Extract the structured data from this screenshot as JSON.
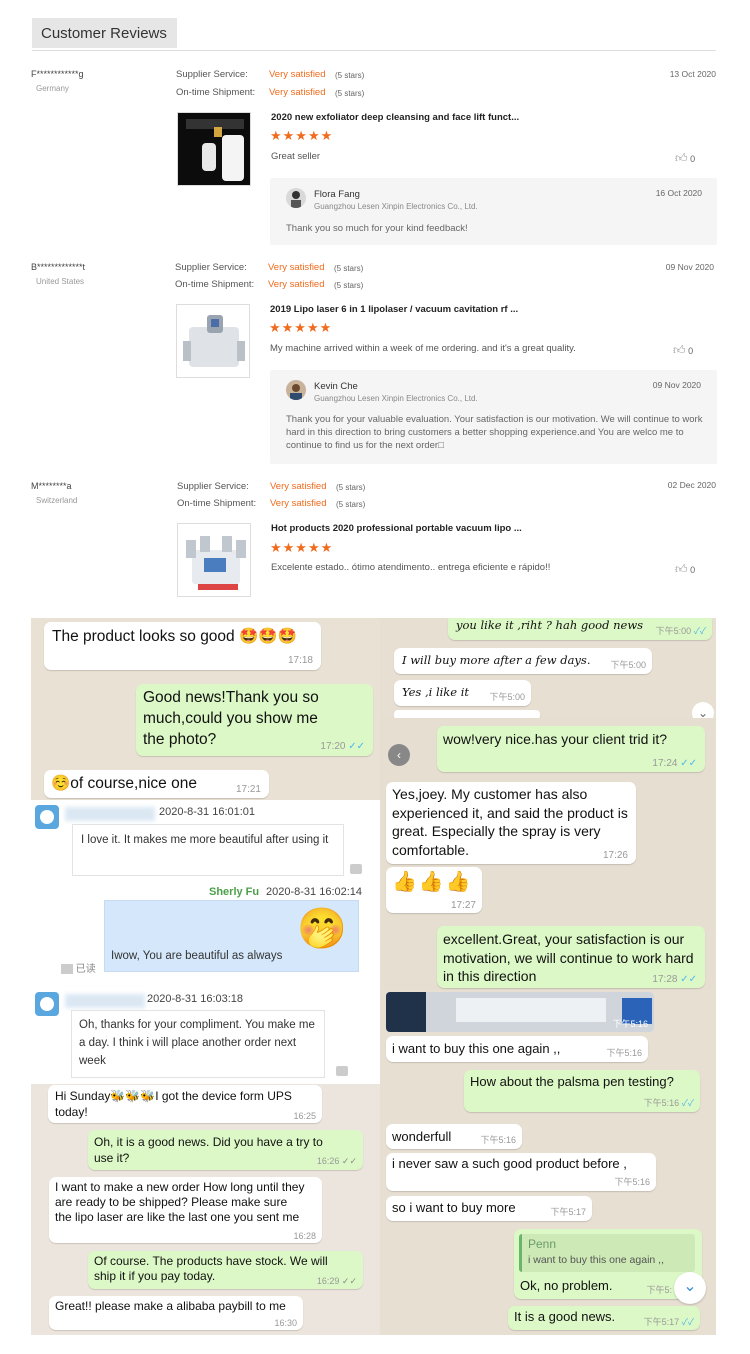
{
  "header": {
    "title": "Customer Reviews"
  },
  "reviews": [
    {
      "name": "F************g",
      "country": "Germany",
      "supplier_label": "Supplier Service:",
      "supplier_value": "Very satisfied",
      "supplier_stars": "(5 stars)",
      "shipment_label": "On-time Shipment:",
      "shipment_value": "Very satisfied",
      "shipment_stars": "(5 stars)",
      "date": "13 Oct 2020",
      "product": "2020 new exfoliator deep cleansing and face lift funct...",
      "rating": "★★★★★",
      "comment": "Great seller",
      "likes": "0",
      "reply": {
        "name": "Flora Fang",
        "company": "Guangzhou Lesen Xinpin Electronics Co., Ltd.",
        "date": "16 Oct 2020",
        "text": "Thank you so much for your kind feedback!"
      }
    },
    {
      "name": "B*************t",
      "country": "United States",
      "supplier_label": "Supplier Service:",
      "supplier_value": "Very satisfied",
      "supplier_stars": "(5 stars)",
      "shipment_label": "On-time Shipment:",
      "shipment_value": "Very satisfied",
      "shipment_stars": "(5 stars)",
      "date": "09 Nov 2020",
      "product": "2019 Lipo laser 6 in 1 lipolaser / vacuum cavitation rf ...",
      "rating": "★★★★★",
      "comment": "My machine arrived within a week of me ordering. and it's a great quality.",
      "likes": "0",
      "reply": {
        "name": "Kevin Che",
        "company": "Guangzhou Lesen Xinpin Electronics Co., Ltd.",
        "date": "09 Nov 2020",
        "text": "Thank you for your valuable evaluation. Your satisfaction is our motivation. We will continue to work hard in this direction to bring customers a better shopping experience.and You are welco me to continue to find us for the next order□"
      }
    },
    {
      "name": "M********a",
      "country": "Switzerland",
      "supplier_label": "Supplier Service:",
      "supplier_value": "Very satisfied",
      "supplier_stars": "(5 stars)",
      "shipment_label": "On-time Shipment:",
      "shipment_value": "Very satisfied",
      "shipment_stars": "(5 stars)",
      "date": "02 Dec 2020",
      "product": "Hot products 2020 professional portable vacuum lipo ...",
      "rating": "★★★★★",
      "comment": "Excelente estado.. ótimo atendimento.. entrega eficiente e rápido!!",
      "likes": "0"
    }
  ],
  "chat_left": {
    "m1": {
      "text": "The product looks so good 🤩🤩🤩",
      "time": "17:18"
    },
    "m2": {
      "text": "Good news!Thank you so much,could you show me the photo?",
      "time": "17:20",
      "check": "✓✓"
    },
    "m3": {
      "text": "☺️of course,nice one",
      "time": "17:21"
    },
    "w1": {
      "date": "2020-8-31 16:01:01",
      "text": "I love it. It makes me more beautiful after using it"
    },
    "w2": {
      "name": "Sherly Fu",
      "date": "2020-8-31 16:02:14",
      "text": "Iwow, You are beautiful as always",
      "read": "已读",
      "emoji": "🤭"
    },
    "w3": {
      "date": "2020-8-31 16:03:18",
      "text": "Oh, thanks for your compliment. You make me a day. I think i will place another order next week"
    },
    "s1": {
      "text": "Hi Sunday🐝🐝🐝I got the device form UPS today!",
      "time": "16:25"
    },
    "s2": {
      "text": "Oh, it is a good news. Did you have a try to use it?",
      "time": "16:26",
      "check": "✓✓"
    },
    "s3": {
      "text": "I want to make a new order How long until they are ready to be shipped? Please make sure the lipo laser are like the last one you sent me",
      "time": "16:28"
    },
    "s4": {
      "text": "Of course. The products have stock. We will ship it if you pay today.",
      "time": "16:29",
      "check": "✓✓"
    },
    "s5": {
      "text": "Great!! please make a alibaba paybill to me",
      "time": "16:30"
    }
  },
  "chat_right": {
    "h1": {
      "text": "you like it ,riht ? hah good news",
      "time": "下午5:00",
      "check": "✓✓"
    },
    "h2": {
      "text": "I will buy more after a few days.",
      "time": "下午5:00"
    },
    "h3": {
      "text": "Yes ,i like it",
      "time": "下午5:00"
    },
    "r1": {
      "text": "wow!very nice.has your client trid it?",
      "time": "17:24",
      "check": "✓✓"
    },
    "r2": {
      "text": "Yes,joey. My customer has also experienced it, and said the product is great. Especially the spray is very comfortable.",
      "time": "17:26"
    },
    "r3": {
      "text": "👍👍👍",
      "time": "17:27"
    },
    "r4": {
      "text": "excellent.Great, your satisfaction is our motivation, we will continue to work hard in this direction",
      "time": "17:28",
      "check": "✓✓"
    },
    "p1": {
      "time": "下午5:16"
    },
    "p2": {
      "text": "i want to buy this one again ,,",
      "time": "下午5:16"
    },
    "p3": {
      "text": "How about the palsma pen testing?",
      "time": "下午5:16",
      "check": "✓✓"
    },
    "p4": {
      "text": "wonderfull",
      "time": "下午5:16"
    },
    "p5": {
      "text": "i never saw a such good product before ,",
      "time": "下午5:16"
    },
    "p6": {
      "text": "so i want to buy more",
      "time": "下午5:17"
    },
    "p7": {
      "quote_name": "Penn",
      "quote_text": "i want to buy this one again ,,",
      "text": "Ok, no problem.",
      "time": "下午5:"
    },
    "p8": {
      "text": "It is a good news.",
      "time": "下午5:17",
      "check": "✓✓"
    }
  },
  "colors": {
    "accent": "#f06b1d",
    "bubble_green": "#dcf8c6",
    "chat_bg": "#e9e1d4",
    "tick_blue": "#4fb6ec"
  }
}
